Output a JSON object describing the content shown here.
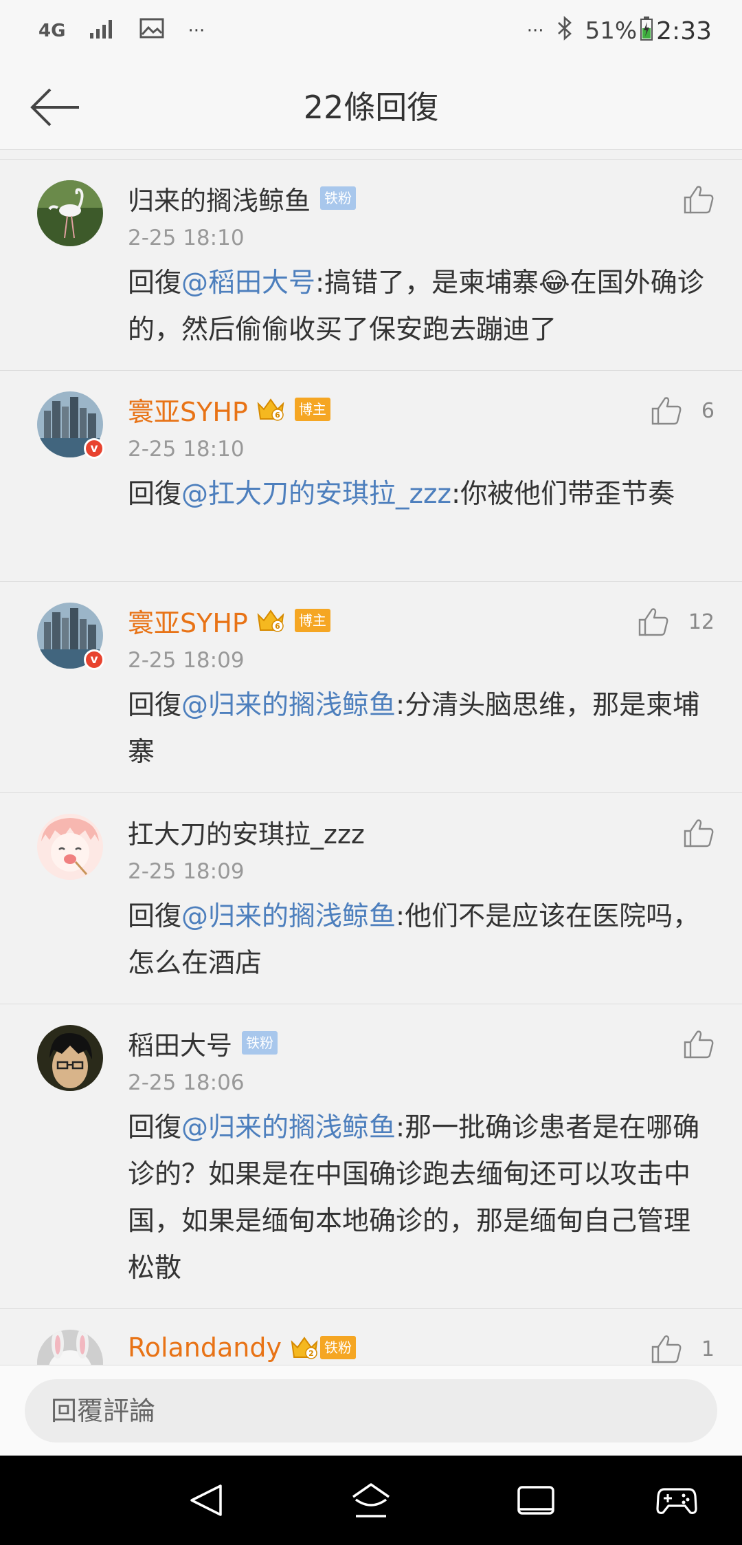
{
  "status_bar": {
    "network": "4G",
    "more": "···",
    "more_right": "···",
    "battery_pct": "51%",
    "time": "2:33"
  },
  "header": {
    "title": "22條回復"
  },
  "comments": [
    {
      "user": "归来的搁浅鲸鱼",
      "badge": "铁粉",
      "time": "2-25 18:10",
      "prefix": "回復",
      "mention": "@稻田大号",
      "text": ":搞错了，是柬埔寨😂在国外确诊的，然后偷偷收买了保安跑去蹦迪了",
      "likes": ""
    },
    {
      "user": "寰亚SYHP",
      "badge": "博主",
      "crown_level": "6",
      "time": "2-25 18:10",
      "prefix": "回復",
      "mention": "@扛大刀的安琪拉_zzz",
      "text": ":你被他们带歪节奏",
      "likes": "6"
    },
    {
      "user": "寰亚SYHP",
      "badge": "博主",
      "crown_level": "6",
      "time": "2-25 18:09",
      "prefix": "回復",
      "mention": "@归来的搁浅鲸鱼",
      "text": ":分清头脑思维，那是柬埔寨",
      "likes": "12"
    },
    {
      "user": "扛大刀的安琪拉_zzz",
      "time": "2-25 18:09",
      "prefix": "回復",
      "mention": "@归来的搁浅鲸鱼",
      "text": ":他们不是应该在医院吗，怎么在酒店",
      "likes": ""
    },
    {
      "user": "稻田大号",
      "badge": "铁粉",
      "time": "2-25 18:06",
      "prefix": "回復",
      "mention": "@归来的搁浅鲸鱼",
      "text": ":那一批确诊患者是在哪确诊的？如果是在中国确诊跑去缅甸还可以攻击中国，如果是缅甸本地确诊的，那是缅甸自己管理松散",
      "likes": ""
    },
    {
      "user": "Rolandandy",
      "badge": "铁粉",
      "crown_level": "2",
      "likes": "1"
    }
  ],
  "reply_bar": {
    "placeholder": "回覆評論"
  },
  "colors": {
    "mention": "#4d7fbd",
    "orange_name": "#e87316",
    "fan_badge": "#a8c7ec",
    "gold_badge": "#f5a623",
    "verified": "#e8432f"
  }
}
